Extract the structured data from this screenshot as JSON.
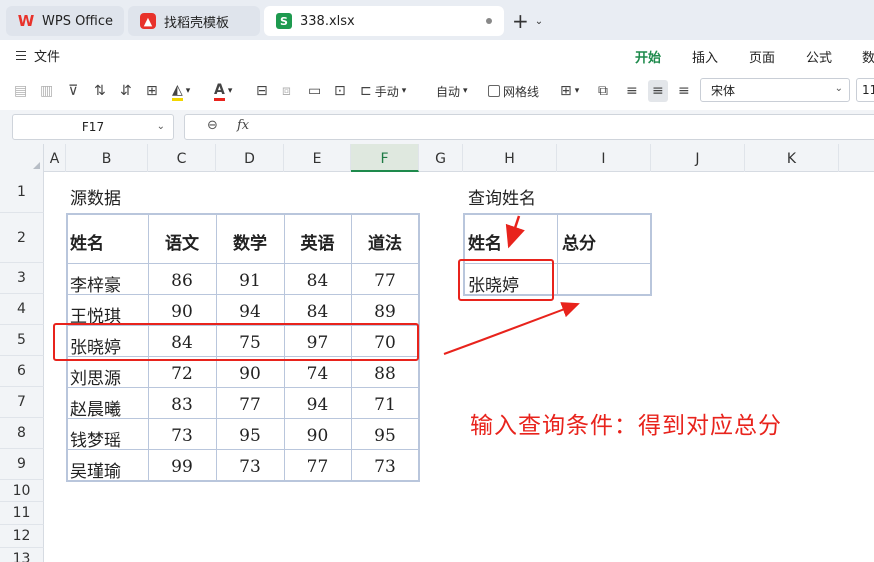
{
  "tabs": [
    {
      "label": "WPS Office",
      "icon": "wps-logo-icon"
    },
    {
      "label": "找稻壳模板",
      "icon": "docer-icon"
    },
    {
      "label": "338.xlsx",
      "icon": "sheet-file-icon",
      "icon_letter": "S"
    }
  ],
  "menu": {
    "file_label": "文件",
    "ribbon_tabs": [
      "开始",
      "插入",
      "页面",
      "公式",
      "数"
    ],
    "active_tab": "开始"
  },
  "toolbar": {
    "wrap_label": "手动",
    "autofit_label": "自动",
    "gridlines_label": "网格线",
    "font_name": "宋体",
    "font_size": "11"
  },
  "formula_bar": {
    "name_box": "F17",
    "fx_label": "fx",
    "formula": ""
  },
  "sheet": {
    "columns": [
      "A",
      "B",
      "C",
      "D",
      "E",
      "F",
      "G",
      "H",
      "I",
      "J",
      "K"
    ],
    "selected_column": "F",
    "rows": [
      "1",
      "2",
      "3",
      "4",
      "5",
      "6",
      "7",
      "8",
      "9",
      "10",
      "11",
      "12",
      "13"
    ],
    "source_title": "源数据",
    "source_headers": [
      "姓名",
      "语文",
      "数学",
      "英语",
      "道法"
    ],
    "source_rows": [
      [
        "李梓豪",
        "86",
        "91",
        "84",
        "77"
      ],
      [
        "王悦琪",
        "90",
        "94",
        "84",
        "89"
      ],
      [
        "张晓婷",
        "84",
        "75",
        "97",
        "70"
      ],
      [
        "刘思源",
        "72",
        "90",
        "74",
        "88"
      ],
      [
        "赵晨曦",
        "83",
        "77",
        "94",
        "71"
      ],
      [
        "钱梦瑶",
        "73",
        "95",
        "90",
        "95"
      ],
      [
        "吴瑾瑜",
        "99",
        "73",
        "77",
        "73"
      ]
    ],
    "query_title": "查询姓名",
    "query_headers": [
      "姓名",
      "总分"
    ],
    "query_name": "张晓婷",
    "query_total": ""
  },
  "annotation": "输入查询条件：得到对应总分",
  "colors": {
    "accent_green": "#1e8a4c",
    "annotation_red": "#e8231c",
    "table_border": "#b9c6dc"
  }
}
